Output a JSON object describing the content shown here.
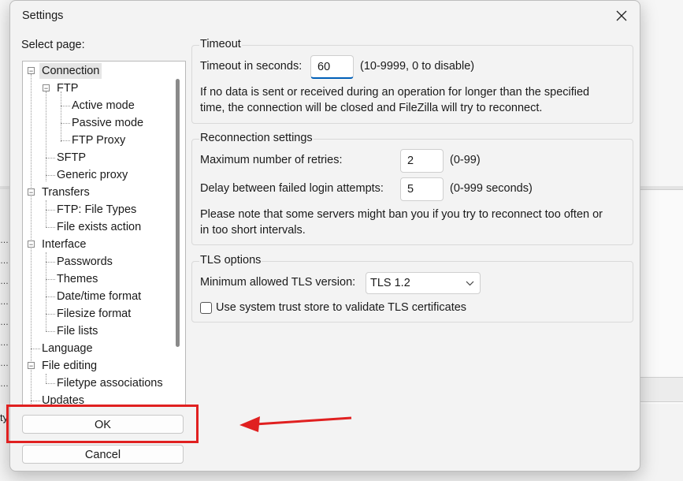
{
  "window": {
    "title": "Settings"
  },
  "select_page_label": "Select page:",
  "tree": {
    "connection": "Connection",
    "ftp": "FTP",
    "active_mode": "Active mode",
    "passive_mode": "Passive mode",
    "ftp_proxy": "FTP Proxy",
    "sftp": "SFTP",
    "generic_proxy": "Generic proxy",
    "transfers": "Transfers",
    "ftp_file_types": "FTP: File Types",
    "file_exists_action": "File exists action",
    "interface": "Interface",
    "passwords": "Passwords",
    "themes": "Themes",
    "date_time_format": "Date/time format",
    "filesize_format": "Filesize format",
    "file_lists": "File lists",
    "language": "Language",
    "file_editing": "File editing",
    "filetype_associations": "Filetype associations",
    "updates": "Updates",
    "selected": "Connection"
  },
  "buttons": {
    "ok": "OK",
    "cancel": "Cancel"
  },
  "timeout": {
    "title": "Timeout",
    "label": "Timeout in seconds:",
    "value": "60",
    "hint": "(10-9999, 0 to disable)",
    "desc_line1": "If no data is sent or received during an operation for longer than the specified",
    "desc_line2": "time, the connection will be closed and FileZilla will try to reconnect."
  },
  "reconnection": {
    "title": "Reconnection settings",
    "retries_label": "Maximum number of retries:",
    "retries_value": "2",
    "retries_hint": "(0-99)",
    "delay_label": "Delay between failed login attempts:",
    "delay_value": "5",
    "delay_hint": "(0-999 seconds)",
    "note_line1": "Please note that some servers might ban you if you try to reconnect too often or",
    "note_line2": "in too short intervals."
  },
  "tls": {
    "title": "TLS options",
    "min_label": "Minimum allowed TLS version:",
    "min_value": "TLS 1.2",
    "trust_label": "Use system trust store to validate TLS certificates",
    "trust_checked": false
  },
  "background": {
    "left_char": "ty"
  },
  "colors": {
    "annotation": "#e02020",
    "accent": "#005fb8"
  }
}
